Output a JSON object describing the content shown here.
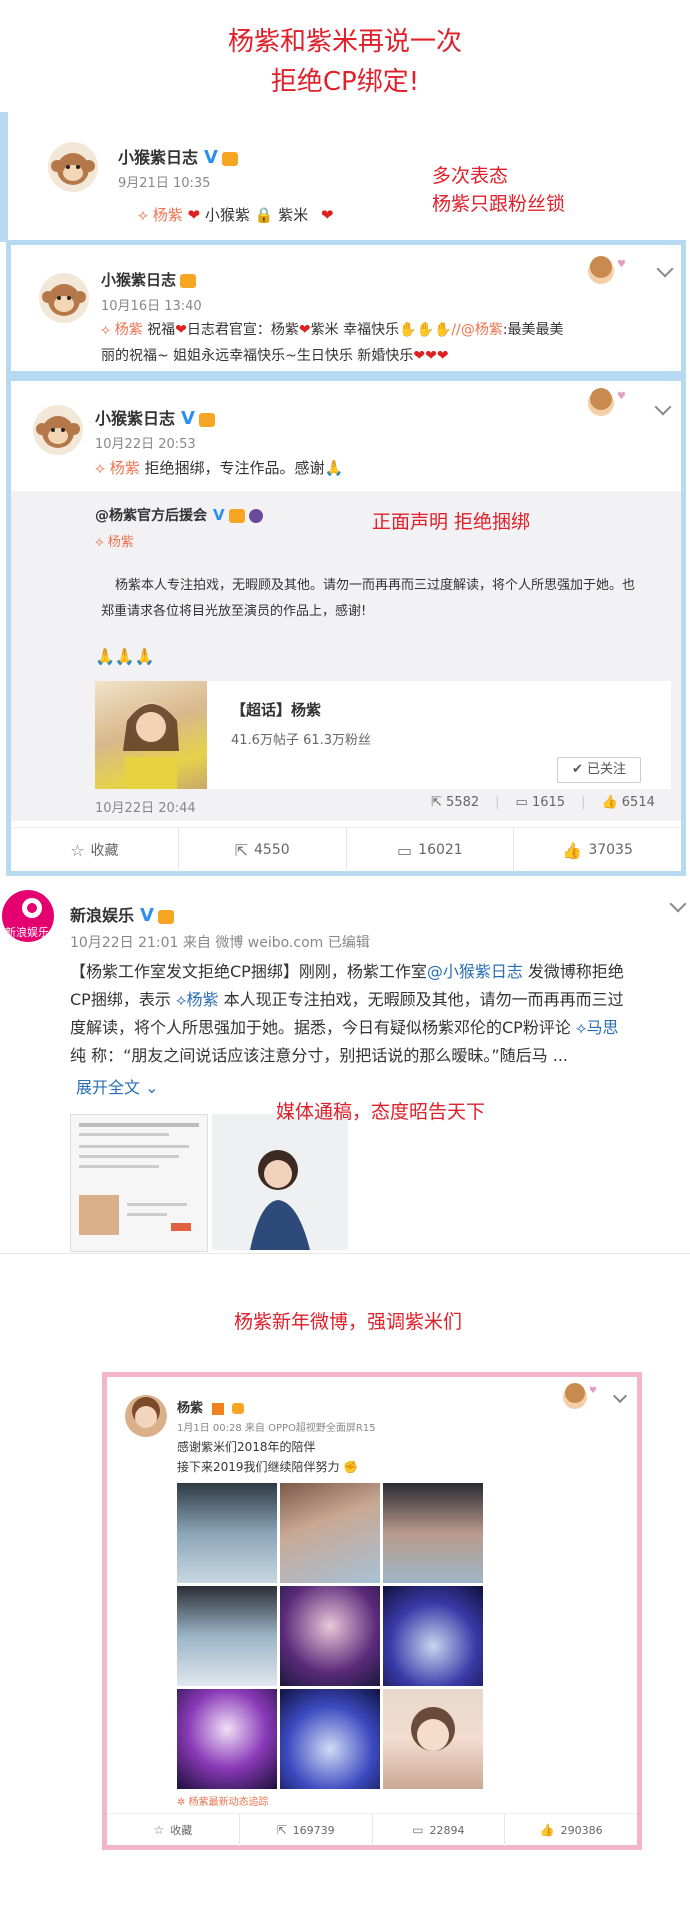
{
  "captions": {
    "top_line1": "杨紫和紫米再说一次",
    "top_line2": "拒绝CP绑定!",
    "note1_line1": "多次表态",
    "note1_line2": "杨紫只跟粉丝锁",
    "note2": "正面声明 拒绝捆绑",
    "note3": "媒体通稿，态度昭告天下",
    "note4": "杨紫新年微博，强调紫米们"
  },
  "post1": {
    "author": "小猴紫日志",
    "time": "9月21日 10:35",
    "tag": "杨紫",
    "text_a": "小猴紫",
    "text_b": "紫米"
  },
  "post2": {
    "author": "小猴紫日志",
    "time": "10月16日 13:40",
    "tag": "杨紫",
    "text_1": " 祝福",
    "text_2": "日志君官宣：杨紫",
    "text_3": "紫米 幸福快乐",
    "mention": "//@杨紫",
    "text_4": ":最美最美",
    "line2": "丽的祝福~ 姐姐永远幸福快乐~生日快乐 新婚快乐"
  },
  "post3": {
    "author": "小猴紫日志",
    "time": "10月22日 20:53",
    "tag": "杨紫",
    "text": " 拒绝捆绑，专注作品。感谢",
    "repost": {
      "author": "@杨紫官方后援会",
      "tag": "杨紫",
      "body_line1": "杨紫本人专注拍戏，无暇顾及其他。请勿一而再再而三过度解读，将个人所思强加于她。也",
      "body_line2": "郑重请求各位将目光放至演员的作品上，感谢!",
      "topic_title": "【超话】杨紫",
      "topic_stats": "41.6万帖子 61.3万粉丝",
      "follow_label": "✔ 已关注",
      "time": "10月22日 20:44",
      "reposts": "5582",
      "comments": "1615",
      "likes": "6514"
    },
    "actions": {
      "collect": "收藏",
      "reposts": "4550",
      "comments": "16021",
      "likes": "37035"
    }
  },
  "post4": {
    "author": "新浪娱乐",
    "avatar_text": "新浪娱乐",
    "meta": "10月22日 21:01 来自 微博 weibo.com  已编辑",
    "line1_a": "【杨紫工作室发文拒绝CP捆绑】刚刚，杨紫工作室",
    "line1_mention": "@小猴紫日志",
    "line1_b": " 发微博称拒绝",
    "line2_a": "CP捆绑，表示 ",
    "line2_tag": "杨紫",
    "line2_b": " 本人现正专注拍戏，无暇顾及其他，请勿一而再再而三过",
    "line3": "度解读，将个人所思强加于她。据悉，今日有疑似杨紫邓伦的CP粉评论 ",
    "line3_tag": "马思",
    "line4": "纯 称：“朋友之间说话应该注意分寸，别把话说的那么暧昧。”随后马 ...",
    "expand": "展开全文"
  },
  "post5": {
    "author": "杨紫",
    "meta": "1月1日 00:28 来自 OPPO超视野全面屏R15",
    "line1": "感谢紫米们2018年的陪伴",
    "line2": "接下来2019我们继续陪伴努力",
    "footer_link": "杨紫最新动态追踪",
    "actions": {
      "collect": "收藏",
      "reposts": "169739",
      "comments": "22894",
      "likes": "290386"
    }
  },
  "colors": {
    "accent_red": "#e0202a",
    "weibo_orange": "#eb7350",
    "link_blue": "#2a6fb5",
    "frame_blue": "#b7d9f2",
    "frame_pink": "#f2b6c8"
  }
}
